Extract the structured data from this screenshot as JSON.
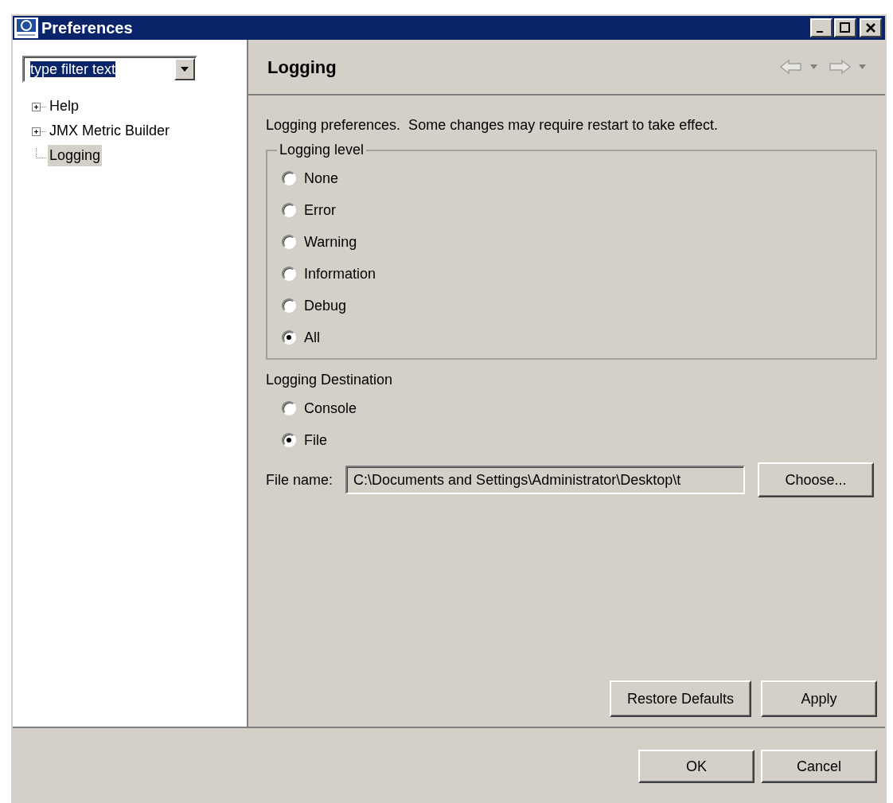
{
  "window": {
    "title": "Preferences"
  },
  "filter": {
    "value": "type filter text",
    "selected": true
  },
  "tree": [
    {
      "label": "Help",
      "kind": "node",
      "expanded": false,
      "selected": false
    },
    {
      "label": "JMX Metric Builder",
      "kind": "node",
      "expanded": false,
      "selected": false
    },
    {
      "label": "Logging",
      "kind": "leaf",
      "selected": true
    }
  ],
  "page": {
    "title": "Logging",
    "nav_enabled": false,
    "description": "Logging preferences.  Some changes may require restart to take effect.",
    "level_group": {
      "title": "Logging level",
      "options": [
        {
          "label": "None",
          "selected": false
        },
        {
          "label": "Error",
          "selected": false
        },
        {
          "label": "Warning",
          "selected": false
        },
        {
          "label": "Information",
          "selected": false
        },
        {
          "label": "Debug",
          "selected": false
        },
        {
          "label": "All",
          "selected": true
        }
      ]
    },
    "destination": {
      "title": "Logging Destination",
      "options": [
        {
          "label": "Console",
          "selected": false
        },
        {
          "label": "File",
          "selected": true
        }
      ]
    },
    "file_name": {
      "label": "File name:",
      "value": "C:\\Documents and Settings\\Administrator\\Desktop\\t",
      "button": "Choose..."
    },
    "buttons": [
      "Restore Defaults",
      "Apply"
    ]
  },
  "dialog_buttons": [
    "OK",
    "Cancel"
  ]
}
